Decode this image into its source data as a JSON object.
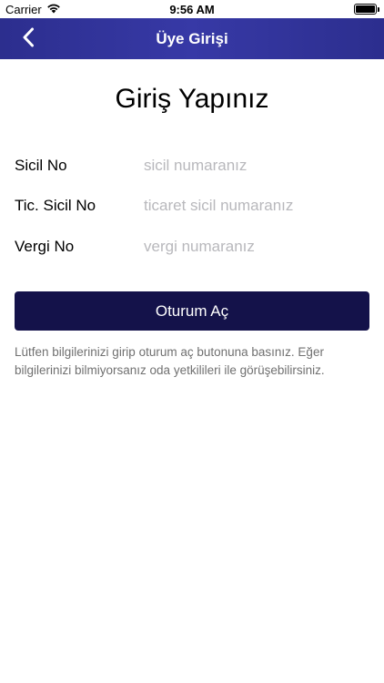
{
  "status_bar": {
    "carrier": "Carrier",
    "time": "9:56 AM"
  },
  "nav": {
    "title": "Üye Girişi",
    "back_icon": "chevron-left-icon"
  },
  "page": {
    "heading": "Giriş Yapınız"
  },
  "form": {
    "fields": [
      {
        "label": "Sicil No",
        "placeholder": "sicil numaranız"
      },
      {
        "label": "Tic. Sicil No",
        "placeholder": "ticaret sicil numaranız"
      },
      {
        "label": "Vergi No",
        "placeholder": "vergi numaranız"
      }
    ],
    "submit_label": "Oturum Aç"
  },
  "info_text": "Lütfen bilgilerinizi girip oturum aç butonuna basınız. Eğer bilgilerinizi bilmiyorsanız oda yetkilileri ile görüşebilirsiniz.",
  "colors": {
    "nav_background": "#3133a0",
    "button_background": "#14124a",
    "placeholder": "#b8b8bc",
    "info_text": "#707070"
  }
}
